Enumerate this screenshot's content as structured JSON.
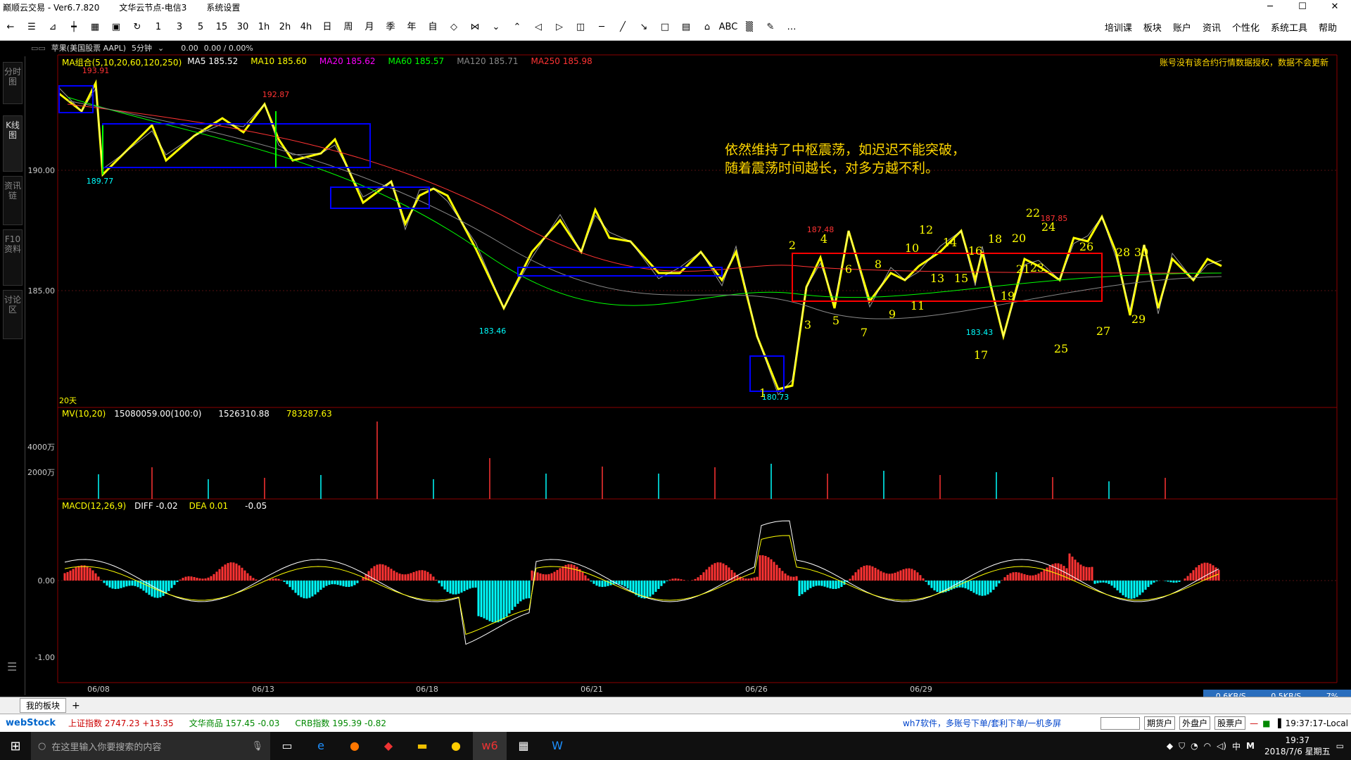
{
  "window": {
    "title": "巅顺云交易 - Ver6.7.820",
    "node": "文华云节点-电信3",
    "menu": "系统设置"
  },
  "toolbar": {
    "periods": [
      "1",
      "3",
      "5",
      "15",
      "30",
      "1h",
      "2h",
      "4h",
      "日",
      "周",
      "月",
      "季",
      "年",
      "自"
    ],
    "right_menu": [
      "培训课",
      "板块",
      "账户",
      "资讯",
      "个性化",
      "系统工具",
      "帮助"
    ]
  },
  "sidebar": {
    "tabs": [
      "分时图",
      "K线图",
      "资讯链",
      "F10资料",
      "讨论区"
    ]
  },
  "instrument": {
    "name": "苹果(美国股票 AAPL)",
    "period": "5分钟",
    "v1": "0.00",
    "v2": "0.00 / 0.00%"
  },
  "ma": {
    "label": "MA组合(5,10,20,60,120,250)",
    "ma5": "MA5 185.52",
    "ma10": "MA10 185.60",
    "ma20": "MA20 185.62",
    "ma60": "MA60 185.57",
    "ma120": "MA120 185.71",
    "ma250": "MA250 185.98"
  },
  "warning": "账号没有该合约行情数据授权，数据不会更新",
  "annotation": {
    "line1": "依然维持了中枢震荡，如迟迟不能突破，",
    "line2": "随着震荡时间越长，对多方越不利。"
  },
  "axis": {
    "p190": "190.00",
    "p185": "185.00",
    "v4000": "4000万",
    "v2000": "2000万",
    "m0": "0.00",
    "m1": "-1.00",
    "days": "20天"
  },
  "price_labels": {
    "h1": "193.91",
    "l1": "189.77",
    "h2": "192.87",
    "l2": "183.46",
    "l3": "180.73",
    "h3": "187.48",
    "l4": "183.43",
    "h4": "187.85"
  },
  "volume": {
    "label": "MV(10,20)",
    "v1": "15080059.00(100:0)",
    "v2": "1526310.88",
    "v3": "783287.63"
  },
  "macd": {
    "label": "MACD(12,26,9)",
    "diff": "DIFF -0.02",
    "dea": "DEA 0.01",
    "macd": "-0.05"
  },
  "dates": [
    "06/08",
    "06/13",
    "06/18",
    "06/21",
    "06/26",
    "06/29"
  ],
  "wave_numbers": [
    "1",
    "2",
    "3",
    "4",
    "5",
    "6",
    "7",
    "8",
    "9",
    "10",
    "11",
    "12",
    "13",
    "14",
    "15",
    "16",
    "17",
    "18",
    "19",
    "20",
    "21",
    "22",
    "23",
    "24",
    "25",
    "26",
    "27",
    "28",
    "29",
    "30"
  ],
  "tab": {
    "plate": "我的板块",
    "add": "+"
  },
  "ticker": {
    "logo": "webStock",
    "i1_name": "上证指数",
    "i1_val": "2747.23 +13.35",
    "i2_name": "文华商品",
    "i2_val": "157.45 -0.03",
    "i3_name": "CRB指数",
    "i3_val": "195.39 -0.82",
    "promo": "wh7软件，多账号下单/套利下单/一机多屏",
    "b1": "期货户",
    "b2": "外盘户",
    "b3": "股票户",
    "time": "19:37:17-Local"
  },
  "net": {
    "down": "0.6KB/S",
    "up": "0.5KB/S",
    "pct": "7%"
  },
  "taskbar": {
    "search": "在这里输入你要搜索的内容",
    "time": "19:37",
    "date": "2018/7/6 星期五",
    "ime": "中"
  },
  "colors": {
    "bg": "#000000",
    "up": "#ff3333",
    "down": "#00ffff",
    "yellow": "#ffff00",
    "blue": "#0000ff",
    "red": "#ff0000",
    "green": "#00ff00",
    "magenta": "#ff00ff"
  }
}
